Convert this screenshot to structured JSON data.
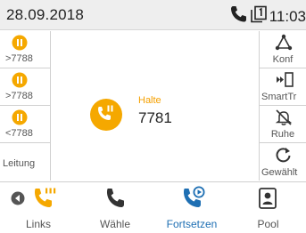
{
  "status_bar": {
    "date": "28.09.2018",
    "time": "11:03"
  },
  "left_keys": [
    {
      "label": ">7788"
    },
    {
      "label": ">7788"
    },
    {
      "label": "<7788"
    },
    {
      "label": "Leitung"
    }
  ],
  "call": {
    "state": "Halte",
    "number": "7781"
  },
  "right_keys": [
    {
      "label": "Konf",
      "icon": "conference-icon"
    },
    {
      "label": "SmartTr",
      "icon": "smart-transfer-icon"
    },
    {
      "label": "Ruhe",
      "icon": "bell-off-icon"
    },
    {
      "label": "Gewählt",
      "icon": "redial-icon"
    }
  ],
  "softkeys": [
    {
      "label": "Links"
    },
    {
      "label": "Wähle"
    },
    {
      "label": "Fortsetzen"
    },
    {
      "label": "Pool"
    }
  ],
  "colors": {
    "hold": "#f5a800",
    "active": "#1e6fb3",
    "icon": "#333333"
  }
}
